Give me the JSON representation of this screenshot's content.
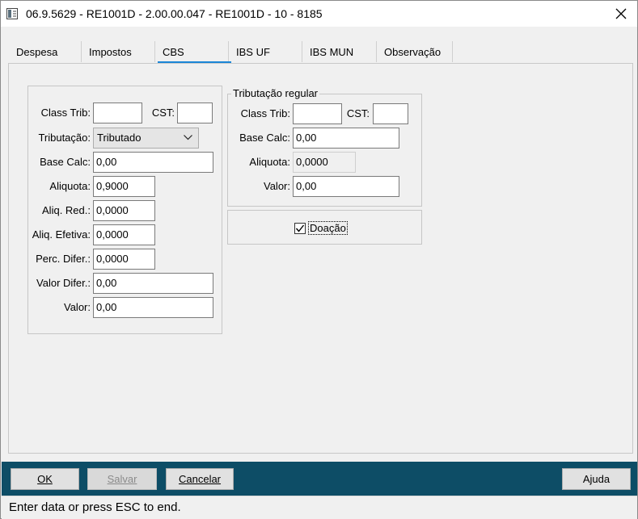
{
  "window": {
    "title": "06.9.5629 - RE1001D - 2.00.00.047 - RE1001D - 10 - 8185",
    "close_icon": "close-icon",
    "app_icon": "window-app-icon"
  },
  "tabs": [
    {
      "label": "Despesa",
      "active": false
    },
    {
      "label": "Impostos",
      "active": false
    },
    {
      "label": "CBS",
      "active": true
    },
    {
      "label": "IBS UF",
      "active": false
    },
    {
      "label": "IBS MUN",
      "active": false
    },
    {
      "label": "Observação",
      "active": false
    }
  ],
  "left_group": {
    "class_trib_label": "Class Trib:",
    "class_trib_value": "",
    "cst_label": "CST:",
    "cst_value": "",
    "tributacao_label": "Tributação:",
    "tributacao_value": "Tributado",
    "base_calc_label": "Base Calc:",
    "base_calc_value": "0,00",
    "aliquota_label": "Aliquota:",
    "aliquota_value": "0,9000",
    "aliq_red_label": "Aliq. Red.:",
    "aliq_red_value": "0,0000",
    "aliq_efetiva_label": "Aliq. Efetiva:",
    "aliq_efetiva_value": "0,0000",
    "perc_difer_label": "Perc. Difer.:",
    "perc_difer_value": "0,0000",
    "valor_difer_label": "Valor Difer.:",
    "valor_difer_value": "0,00",
    "valor_label": "Valor:",
    "valor_value": "0,00"
  },
  "regular_group": {
    "title": "Tributação regular",
    "class_trib_label": "Class Trib:",
    "class_trib_value": "",
    "cst_label": "CST:",
    "cst_value": "",
    "base_calc_label": "Base Calc:",
    "base_calc_value": "0,00",
    "aliquota_label": "Aliquota:",
    "aliquota_value": "0,0000",
    "valor_label": "Valor:",
    "valor_value": "0,00"
  },
  "doacao": {
    "label": "Doação",
    "checked": true
  },
  "buttons": {
    "ok": "OK",
    "salvar": "Salvar",
    "cancelar": "Cancelar",
    "ajuda": "Ajuda"
  },
  "status": {
    "text": "Enter data or press ESC to end."
  },
  "colors": {
    "bottom_bar": "#0d4d66",
    "tab_accent": "#1b86d6"
  }
}
